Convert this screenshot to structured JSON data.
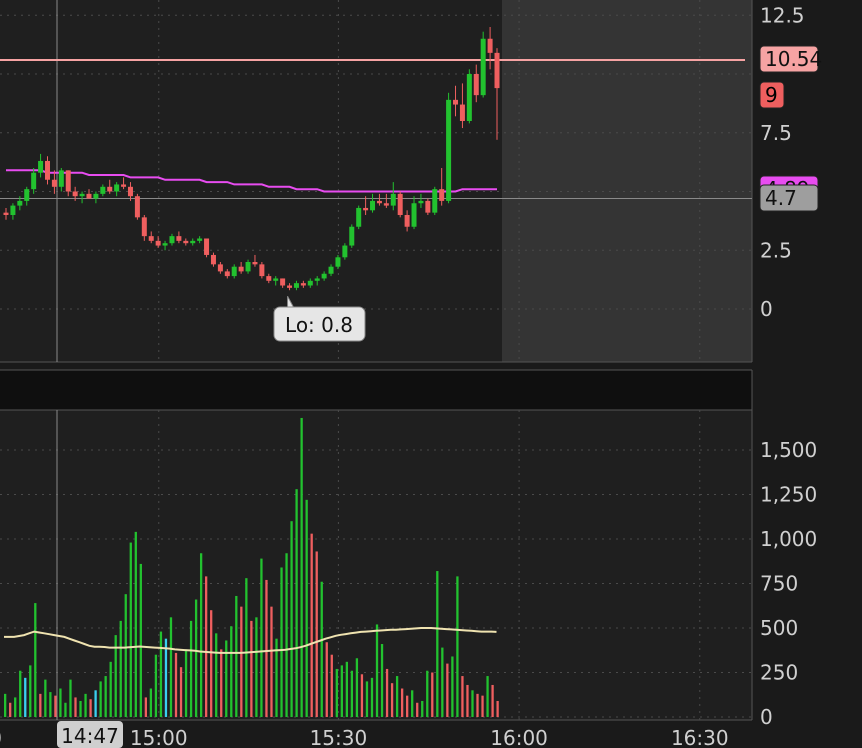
{
  "chart_data": [
    {
      "type": "candlestick",
      "panel": "price",
      "ylim": [
        -1,
        13
      ],
      "y_ticks": [
        0,
        2.5,
        7.5,
        12.5
      ],
      "y_tick_labels": [
        "0",
        "2.5",
        "7.5",
        "12.5"
      ],
      "price_line": 10.54,
      "price_line_color": "#f6a3a3",
      "vwap_color": "#e84cf0",
      "up_color": "#22c22f",
      "down_color": "#ef5f5f",
      "badges": [
        {
          "label": "10.54",
          "value": 10.54,
          "color": "#f6a3a3"
        },
        {
          "label": "9",
          "value": 9.3,
          "color": "#ef5f5f"
        },
        {
          "label": "4.89",
          "value": 4.98,
          "color": "#e84cf0"
        },
        {
          "label": "4.7",
          "value": 4.7,
          "color": "#9e9e9e"
        }
      ],
      "crosshair_y": 4.7,
      "crosshair_time": "14:47",
      "low_label": "Lo: 0.8",
      "low_value": 0.8,
      "low_index": 41,
      "vwap": [
        5.9,
        5.9,
        5.9,
        5.9,
        5.9,
        5.9,
        5.8,
        5.8,
        5.8,
        5.8,
        5.8,
        5.8,
        5.7,
        5.7,
        5.7,
        5.7,
        5.7,
        5.7,
        5.6,
        5.6,
        5.6,
        5.6,
        5.6,
        5.5,
        5.5,
        5.5,
        5.5,
        5.5,
        5.5,
        5.4,
        5.4,
        5.4,
        5.4,
        5.3,
        5.3,
        5.3,
        5.3,
        5.3,
        5.2,
        5.2,
        5.2,
        5.2,
        5.1,
        5.1,
        5.1,
        5.1,
        5.0,
        5.0,
        5.0,
        5.0,
        5.0,
        5.0,
        5.0,
        5.0,
        5.0,
        5.0,
        5.0,
        5.0,
        5.0,
        5.0,
        5.0,
        5.0,
        5.0,
        5.0,
        5.0,
        5.0,
        5.1,
        5.1,
        5.1,
        5.1,
        5.1,
        5.1
      ],
      "candles": [
        [
          4.1,
          4.3,
          3.8,
          4.0
        ],
        [
          4.0,
          4.5,
          3.8,
          4.4
        ],
        [
          4.4,
          4.8,
          4.2,
          4.6
        ],
        [
          4.6,
          5.2,
          4.4,
          5.1
        ],
        [
          5.1,
          6.0,
          4.9,
          5.8
        ],
        [
          5.8,
          6.6,
          5.6,
          6.3
        ],
        [
          6.3,
          6.5,
          5.3,
          5.5
        ],
        [
          5.5,
          5.9,
          4.9,
          5.2
        ],
        [
          5.2,
          6.0,
          5.0,
          5.9
        ],
        [
          5.9,
          5.9,
          4.8,
          5.0
        ],
        [
          5.0,
          5.2,
          4.6,
          4.8
        ],
        [
          4.8,
          5.0,
          4.5,
          4.9
        ],
        [
          4.9,
          5.1,
          4.7,
          4.7
        ],
        [
          4.7,
          5.0,
          4.5,
          4.9
        ],
        [
          4.9,
          5.3,
          4.8,
          5.2
        ],
        [
          5.2,
          5.5,
          4.9,
          5.0
        ],
        [
          5.0,
          5.4,
          4.8,
          5.3
        ],
        [
          5.3,
          5.6,
          5.1,
          5.2
        ],
        [
          5.2,
          5.4,
          4.6,
          4.8
        ],
        [
          4.8,
          4.9,
          3.8,
          3.9
        ],
        [
          3.9,
          4.0,
          2.9,
          3.1
        ],
        [
          3.1,
          3.3,
          2.8,
          2.9
        ],
        [
          2.9,
          3.1,
          2.6,
          2.7
        ],
        [
          2.7,
          2.9,
          2.5,
          2.8
        ],
        [
          2.8,
          3.2,
          2.7,
          3.1
        ],
        [
          3.1,
          3.3,
          2.8,
          2.9
        ],
        [
          2.9,
          3.0,
          2.7,
          2.8
        ],
        [
          2.8,
          3.0,
          2.7,
          2.9
        ],
        [
          2.9,
          3.1,
          2.8,
          3.0
        ],
        [
          3.0,
          3.0,
          2.2,
          2.3
        ],
        [
          2.3,
          2.4,
          1.8,
          1.9
        ],
        [
          1.9,
          2.0,
          1.5,
          1.6
        ],
        [
          1.6,
          1.7,
          1.3,
          1.4
        ],
        [
          1.4,
          1.9,
          1.3,
          1.8
        ],
        [
          1.8,
          2.0,
          1.5,
          1.6
        ],
        [
          1.6,
          2.1,
          1.5,
          2.0
        ],
        [
          2.0,
          2.3,
          1.8,
          1.9
        ],
        [
          1.9,
          2.0,
          1.3,
          1.4
        ],
        [
          1.4,
          1.5,
          1.1,
          1.2
        ],
        [
          1.2,
          1.4,
          1.0,
          1.3
        ],
        [
          1.3,
          1.3,
          0.9,
          1.0
        ],
        [
          1.0,
          1.1,
          0.8,
          0.9
        ],
        [
          0.9,
          1.2,
          0.8,
          1.1
        ],
        [
          1.1,
          1.2,
          0.9,
          1.0
        ],
        [
          1.0,
          1.3,
          0.9,
          1.2
        ],
        [
          1.2,
          1.4,
          1.0,
          1.3
        ],
        [
          1.3,
          1.6,
          1.2,
          1.5
        ],
        [
          1.5,
          1.9,
          1.4,
          1.8
        ],
        [
          1.8,
          2.3,
          1.7,
          2.2
        ],
        [
          2.2,
          2.8,
          2.1,
          2.7
        ],
        [
          2.7,
          3.6,
          2.6,
          3.5
        ],
        [
          3.5,
          4.4,
          3.4,
          4.3
        ],
        [
          4.3,
          4.8,
          4.0,
          4.2
        ],
        [
          4.2,
          4.9,
          4.1,
          4.6
        ],
        [
          4.6,
          4.9,
          4.4,
          4.5
        ],
        [
          4.5,
          4.9,
          4.3,
          4.4
        ],
        [
          4.4,
          5.4,
          4.2,
          4.9
        ],
        [
          4.9,
          5.0,
          3.9,
          4.0
        ],
        [
          4.0,
          4.2,
          3.3,
          3.5
        ],
        [
          3.5,
          4.8,
          3.4,
          4.5
        ],
        [
          4.5,
          4.9,
          4.3,
          4.6
        ],
        [
          4.6,
          4.7,
          4.0,
          4.1
        ],
        [
          4.1,
          5.2,
          4.0,
          5.1
        ],
        [
          5.1,
          6.0,
          4.4,
          4.6
        ],
        [
          4.6,
          9.2,
          4.5,
          8.9
        ],
        [
          8.9,
          9.5,
          8.2,
          8.7
        ],
        [
          8.7,
          9.6,
          7.7,
          8.0
        ],
        [
          8.0,
          10.2,
          7.9,
          10.0
        ],
        [
          10.0,
          10.4,
          8.8,
          9.1
        ],
        [
          9.1,
          11.8,
          9.0,
          11.5
        ],
        [
          11.5,
          12.0,
          10.2,
          10.9
        ],
        [
          10.9,
          11.1,
          7.2,
          9.4
        ]
      ],
      "xlim": [
        0,
        72
      ],
      "x_tick_positions": [
        15.2,
        32.4,
        49.7,
        67.0
      ],
      "x_tick_labels": [
        "15:00",
        "15:30",
        "16:00",
        "16:30"
      ]
    },
    {
      "type": "bar",
      "panel": "volume",
      "ylim": [
        0,
        1750
      ],
      "y_ticks": [
        0,
        250,
        500,
        750,
        1000,
        1250,
        1500
      ],
      "y_tick_labels": [
        "0",
        "250",
        "500",
        "750",
        "1,000",
        "1,250",
        "1,500"
      ],
      "avg_color": "#efe3b0",
      "volumes": [
        130,
        80,
        110,
        260,
        220,
        290,
        640,
        130,
        210,
        140,
        120,
        160,
        80,
        210,
        110,
        90,
        130,
        100,
        150,
        200,
        230,
        310,
        460,
        540,
        690,
        980,
        1040,
        860,
        110,
        160,
        350,
        480,
        440,
        560,
        360,
        280,
        380,
        540,
        660,
        920,
        790,
        600,
        470,
        380,
        430,
        510,
        680,
        620,
        780,
        540,
        560,
        890,
        770,
        620,
        440,
        840,
        920,
        1100,
        1280,
        1680,
        1220,
        1030,
        930,
        760,
        420,
        350,
        270,
        290,
        310,
        260,
        330,
        240,
        200,
        220,
        520,
        410,
        270,
        190,
        230,
        160,
        120,
        150,
        80,
        90,
        260,
        250,
        820,
        390,
        300,
        340,
        790,
        230,
        180,
        150,
        130,
        120,
        230,
        180,
        90
      ],
      "avg": [
        450,
        450,
        450,
        455,
        460,
        470,
        480,
        475,
        470,
        465,
        460,
        455,
        450,
        440,
        430,
        420,
        410,
        400,
        395,
        395,
        393,
        390,
        390,
        390,
        390,
        392,
        394,
        396,
        394,
        392,
        390,
        388,
        386,
        384,
        380,
        378,
        376,
        374,
        372,
        368,
        366,
        364,
        362,
        360,
        360,
        360,
        360,
        360,
        362,
        364,
        366,
        368,
        370,
        372,
        374,
        376,
        378,
        382,
        386,
        392,
        400,
        410,
        420,
        430,
        440,
        448,
        456,
        462,
        466,
        470,
        474,
        478,
        480,
        482,
        484,
        486,
        488,
        490,
        490,
        492,
        494,
        496,
        498,
        500,
        500,
        500,
        498,
        496,
        494,
        492,
        490,
        488,
        486,
        484,
        482,
        480,
        480,
        480,
        478
      ],
      "x_tick_positions": [
        15.2,
        32.4,
        49.7,
        67.0
      ],
      "x_tick_labels": [
        "15:00",
        "15:30",
        "16:00",
        "16:30"
      ],
      "crosshair_time": "14:47"
    }
  ]
}
